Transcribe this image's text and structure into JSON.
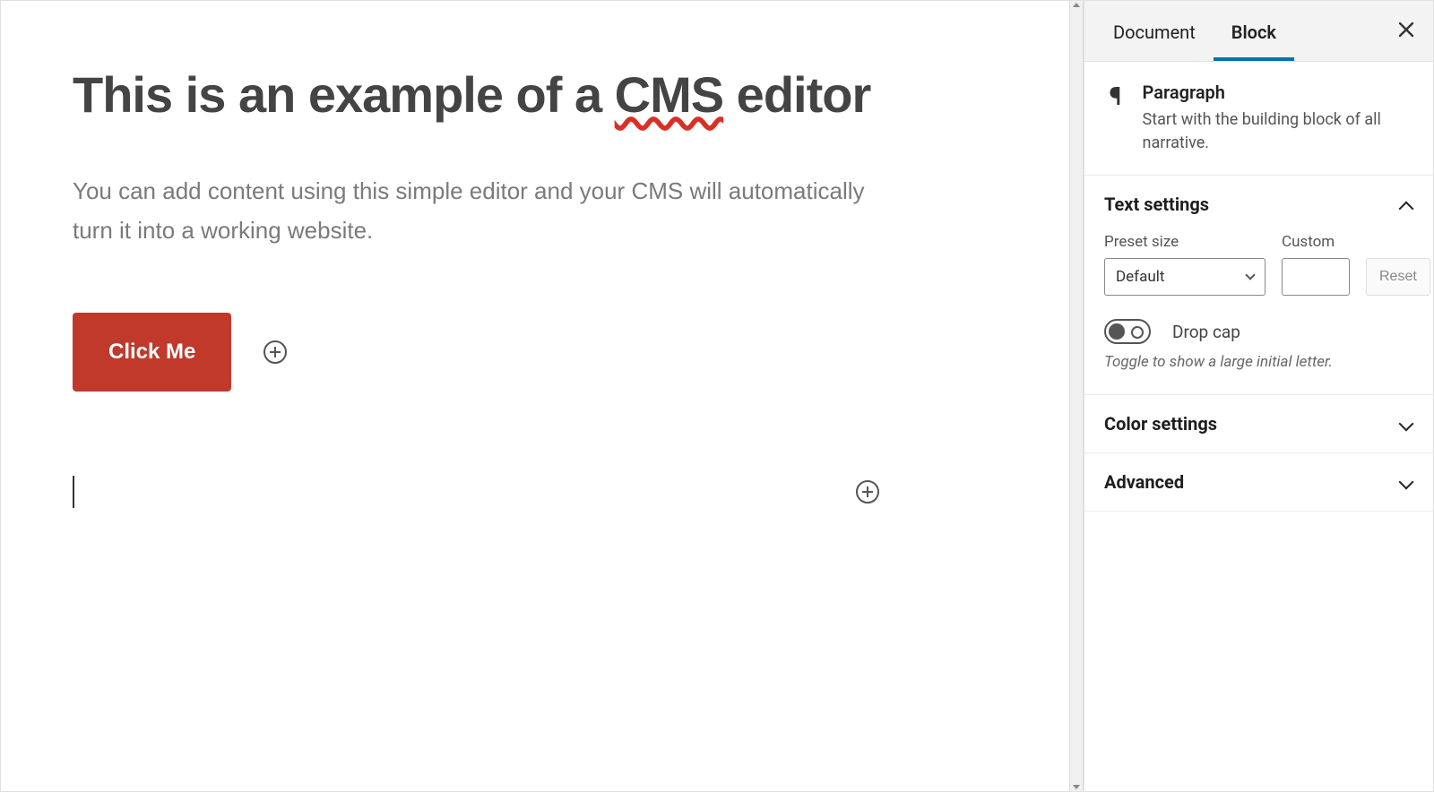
{
  "editor": {
    "title_pre": "This is an example of a ",
    "title_spell": "CMS",
    "title_post": " editor",
    "paragraph": "You can add content using this simple editor and your CMS will automatically turn it into a working website.",
    "button_label": "Click Me"
  },
  "sidebar": {
    "tabs": {
      "document": "Document",
      "block": "Block"
    },
    "block": {
      "name": "Paragraph",
      "desc": "Start with the building block of all narrative."
    },
    "text_settings": {
      "title": "Text settings",
      "preset_label": "Preset size",
      "preset_value": "Default",
      "custom_label": "Custom",
      "custom_value": "",
      "reset": "Reset",
      "dropcap_label": "Drop cap",
      "dropcap_help": "Toggle to show a large initial letter."
    },
    "color_settings": {
      "title": "Color settings"
    },
    "advanced": {
      "title": "Advanced"
    }
  }
}
